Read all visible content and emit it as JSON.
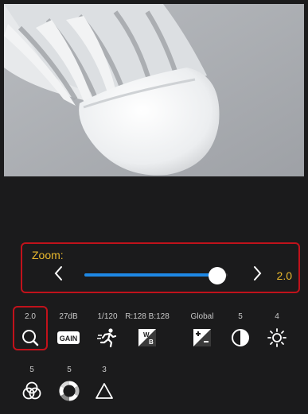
{
  "zoom_panel": {
    "label": "Zoom:",
    "value": "2.0",
    "level_fraction": 0.93
  },
  "controls": [
    {
      "label": "2.0",
      "icon": "zoom-magnifier-icon",
      "name": "zoom"
    },
    {
      "label": "27dB",
      "icon": "gain-icon",
      "name": "gain",
      "icon_text": "GAIN"
    },
    {
      "label": "1/120",
      "icon": "shutter-runner-icon",
      "name": "shutter"
    },
    {
      "label": "R:128 B:128",
      "icon": "white-balance-icon",
      "name": "white-balance"
    },
    {
      "label": "Global",
      "icon": "exposure-icon",
      "name": "exposure"
    },
    {
      "label": "5",
      "icon": "contrast-icon",
      "name": "contrast"
    },
    {
      "label": "4",
      "icon": "brightness-icon",
      "name": "brightness"
    },
    {
      "label": "5",
      "icon": "color-circles-icon",
      "name": "saturation"
    },
    {
      "label": "5",
      "icon": "hue-ring-icon",
      "name": "hue"
    },
    {
      "label": "3",
      "icon": "sharpness-triangle-icon",
      "name": "sharpness"
    }
  ],
  "colors": {
    "accent": "#e9b82d",
    "highlight": "#c1121b",
    "slider": "#1e88e5",
    "background": "#1b1b1c"
  }
}
